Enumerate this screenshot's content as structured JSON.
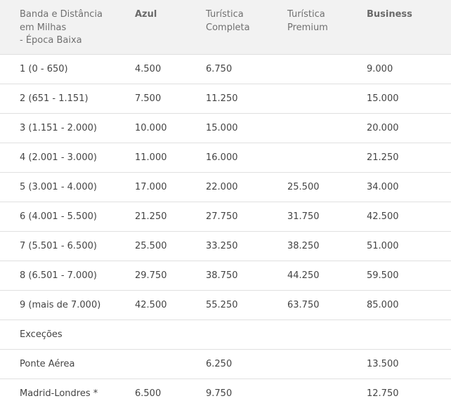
{
  "table": {
    "headers": [
      "Banda e Distância\nem Milhas\n- Época Baixa",
      "Azul",
      "Turística\nCompleta",
      "Turística\nPremium",
      "Business"
    ],
    "rows": [
      [
        "1 (0 - 650)",
        "4.500",
        "6.750",
        "",
        "9.000"
      ],
      [
        "2 (651 - 1.151)",
        "7.500",
        "11.250",
        "",
        "15.000"
      ],
      [
        "3 (1.151 - 2.000)",
        "10.000",
        "15.000",
        "",
        "20.000"
      ],
      [
        "4 (2.001 - 3.000)",
        "11.000",
        "16.000",
        "",
        "21.250"
      ],
      [
        "5 (3.001 - 4.000)",
        "17.000",
        "22.000",
        "25.500",
        "34.000"
      ],
      [
        "6 (4.001 - 5.500)",
        "21.250",
        "27.750",
        "31.750",
        "42.500"
      ],
      [
        "7 (5.501 - 6.500)",
        "25.500",
        "33.250",
        "38.250",
        "51.000"
      ],
      [
        "8 (6.501 - 7.000)",
        "29.750",
        "38.750",
        "44.250",
        "59.500"
      ],
      [
        "9 (mais de 7.000)",
        "42.500",
        "55.250",
        "63.750",
        "85.000"
      ],
      [
        "Exceções",
        "",
        "",
        "",
        ""
      ],
      [
        "Ponte Aérea",
        "",
        "6.250",
        "",
        "13.500"
      ],
      [
        "Madrid-Londres *",
        "6.500",
        "9.750",
        "",
        "12.750"
      ]
    ]
  }
}
